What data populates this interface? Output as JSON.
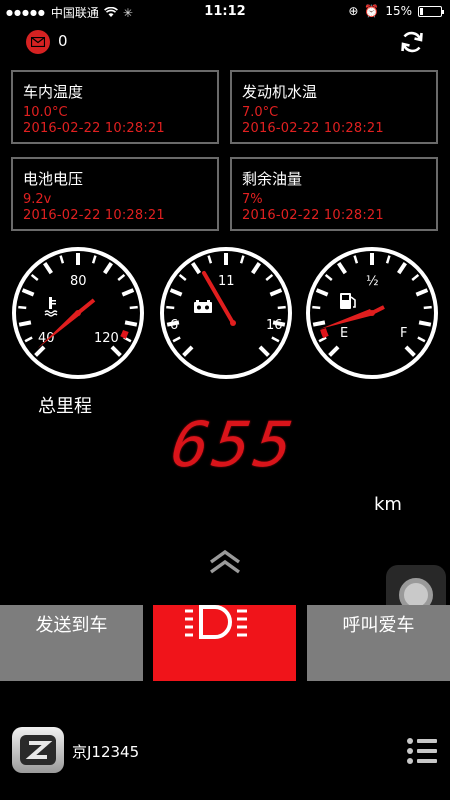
{
  "status_bar": {
    "carrier": "中国联通",
    "time": "11:12",
    "battery": "15%",
    "battery_level": 0.15
  },
  "header": {
    "message_count": "0"
  },
  "cards": [
    {
      "title": "车内温度",
      "value": "10.0°C",
      "time": "2016-02-22 10:28:21"
    },
    {
      "title": "发动机水温",
      "value": "7.0°C",
      "time": "2016-02-22 10:28:21"
    },
    {
      "title": "电池电压",
      "value": "9.2v",
      "time": "2016-02-22 10:28:21"
    },
    {
      "title": "剩余油量",
      "value": "7%",
      "time": "2016-02-22 10:28:21"
    }
  ],
  "gauges": {
    "temperature": {
      "labels": [
        "40",
        "80",
        "120"
      ]
    },
    "voltage": {
      "labels": [
        "6",
        "11",
        "16"
      ]
    },
    "fuel": {
      "labels": [
        "E",
        "½",
        "F"
      ]
    }
  },
  "odometer": {
    "label": "总里程",
    "value": "655",
    "unit": "km"
  },
  "actions": {
    "send_to_car": "发送到车",
    "call_car": "呼叫爱车"
  },
  "footer": {
    "plate": "京J12345"
  },
  "colors": {
    "accent_red": "#e02020",
    "button_red": "#f0141a",
    "button_gray": "#7d7d7d",
    "card_border": "#6a6a6a"
  }
}
